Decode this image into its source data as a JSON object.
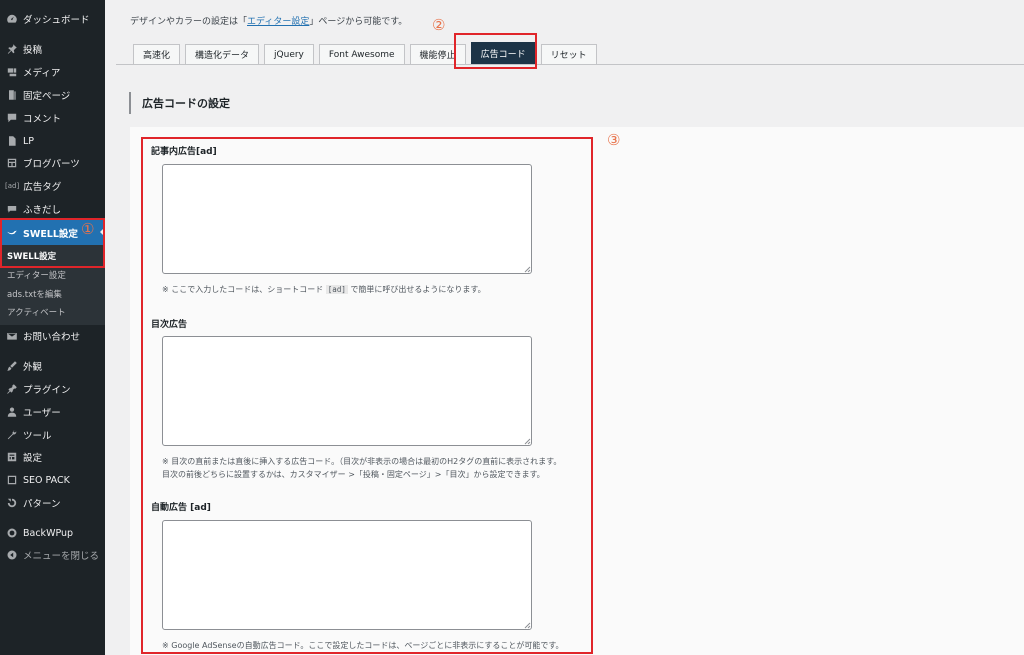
{
  "sidebar": {
    "items": [
      {
        "label": "ダッシュボード",
        "icon": "dashboard-icon"
      },
      {
        "label": "投稿",
        "icon": "pin-icon"
      },
      {
        "label": "メディア",
        "icon": "media-icon"
      },
      {
        "label": "固定ページ",
        "icon": "page-icon"
      },
      {
        "label": "コメント",
        "icon": "comment-icon"
      },
      {
        "label": "LP",
        "icon": "document-icon"
      },
      {
        "label": "ブログパーツ",
        "icon": "layout-icon"
      },
      {
        "label": "広告タグ",
        "icon": "ad-icon",
        "glyph": "[ad]"
      },
      {
        "label": "ふきだし",
        "icon": "bubble-icon"
      },
      {
        "label": "SWELL設定",
        "icon": "swell-bird-icon"
      },
      {
        "label": "お問い合わせ",
        "icon": "mail-icon"
      },
      {
        "label": "外観",
        "icon": "brush-icon"
      },
      {
        "label": "プラグイン",
        "icon": "plugin-icon"
      },
      {
        "label": "ユーザー",
        "icon": "user-icon"
      },
      {
        "label": "ツール",
        "icon": "wrench-icon"
      },
      {
        "label": "設定",
        "icon": "settings-icon"
      },
      {
        "label": "SEO PACK",
        "icon": "seo-icon"
      },
      {
        "label": "パターン",
        "icon": "pattern-icon"
      },
      {
        "label": "BackWPup",
        "icon": "backwpup-icon"
      },
      {
        "label": "メニューを閉じる",
        "icon": "collapse-icon"
      }
    ],
    "submenu": [
      {
        "label": "SWELL設定"
      },
      {
        "label": "エディター設定"
      },
      {
        "label": "ads.txtを編集"
      },
      {
        "label": "アクティベート"
      }
    ]
  },
  "annotations": {
    "one": "①",
    "two": "②",
    "three": "③"
  },
  "header": {
    "desc_prefix": "デザインやカラーの設定は「",
    "desc_link": "エディター設定",
    "desc_suffix": "」ページから可能です。"
  },
  "tabs": [
    "高速化",
    "構造化データ",
    "jQuery",
    "Font Awesome",
    "機能停止",
    "広告コード",
    "リセット"
  ],
  "active_tab": "広告コード",
  "section_title": "広告コードの設定",
  "fields": [
    {
      "label": "記事内広告[ad]",
      "value": "",
      "note_before": "※ ここで入力したコードは、ショートコード",
      "note_code": "[ad]",
      "note_after": "で簡単に呼び出せるようになります。"
    },
    {
      "label": "目次広告",
      "value": "",
      "note_line1": "※ 目次の直前または直後に挿入する広告コード。（目次が非表示の場合は最初のH2タグの直前に表示されます。",
      "note_line2": "目次の前後どちらに設置するかは、カスタマイザー >「投稿・固定ページ」>「目次」から設定できます。"
    },
    {
      "label": "自動広告 [ad]",
      "value": "",
      "note": "※ Google AdSenseの自動広告コード。ここで設定したコードは、ページごとに非表示にすることが可能です。"
    }
  ],
  "colors": {
    "sidebar_bg": "#1d2327",
    "active_blue": "#2271b1",
    "annotation_red": "#e0252a",
    "annotation_orange": "#e8734b",
    "active_tab_bg": "#1d3447"
  }
}
